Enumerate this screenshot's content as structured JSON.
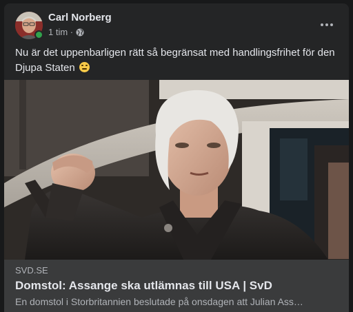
{
  "post": {
    "author": "Carl Norberg",
    "timestamp": "1 tim ·",
    "privacy_icon": "globe-icon",
    "more_icon": "more-options-icon",
    "text": "Nu är det uppenbarligen rätt så begränsat med handlingsfrihet för den Djupa Staten",
    "emoji": "smirking-face-emoji"
  },
  "link_preview": {
    "domain": "SVD.SE",
    "title": "Domstol: Assange ska utlämnas till USA | SvD",
    "description": "En domstol i Storbritannien beslutade på onsdagen att Julian Ass…"
  },
  "colors": {
    "page_bg": "#18191a",
    "card_bg": "#242526",
    "footer_bg": "#3a3b3c",
    "primary_text": "#e4e6eb",
    "secondary_text": "#b0b3b8",
    "online": "#31a24c"
  }
}
